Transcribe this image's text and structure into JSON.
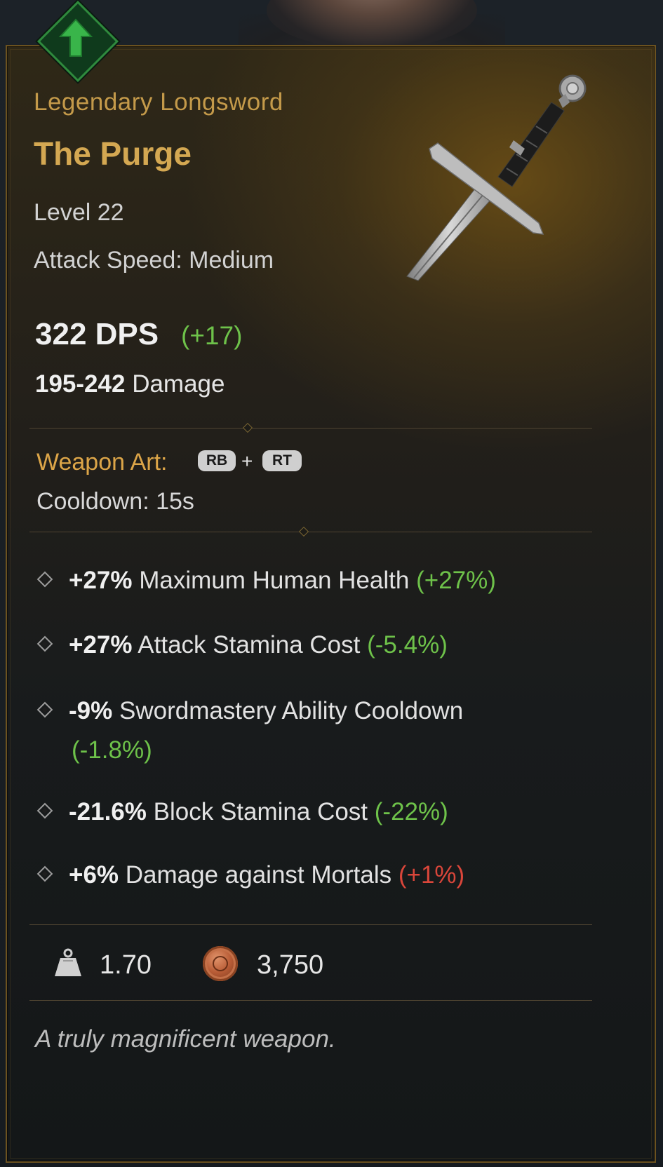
{
  "item": {
    "type": "Legendary Longsword",
    "name": "The Purge",
    "level": "Level 22",
    "attack_speed": "Attack Speed: Medium",
    "dps": "322 DPS",
    "dps_delta": "(+17)",
    "damage_range": "195-242",
    "damage_label": "Damage",
    "upgrade_indicator": "up-arrow-icon"
  },
  "weapon_art": {
    "label": "Weapon Art:",
    "button_1": "RB",
    "plus": "+",
    "button_2": "RT",
    "cooldown": "Cooldown: 15s"
  },
  "perks": [
    {
      "value": "+27%",
      "text": "Maximum Human Health",
      "delta": "(+27%)",
      "delta_color": "green"
    },
    {
      "value": "+27%",
      "text": "Attack Stamina Cost",
      "delta": "(-5.4%)",
      "delta_color": "green"
    },
    {
      "value": "-9%",
      "text": "Swordmastery Ability Cooldown",
      "delta": "(-1.8%)",
      "delta_color": "green"
    },
    {
      "value": "-21.6%",
      "text": "Block Stamina Cost",
      "delta": "(-22%)",
      "delta_color": "green"
    },
    {
      "value": "+6%",
      "text": "Damage against Mortals",
      "delta": "(+1%)",
      "delta_color": "red"
    }
  ],
  "footer": {
    "weight_icon": "weight-icon",
    "weight": "1.70",
    "coin_icon": "coin-icon",
    "price": "3,750"
  },
  "flavor_text": "A truly magnificent weapon.",
  "colors": {
    "rarity": "#c49a4a",
    "positive": "#6ec24a",
    "negative": "#d9463a",
    "weapon_art_label": "#dca548"
  }
}
